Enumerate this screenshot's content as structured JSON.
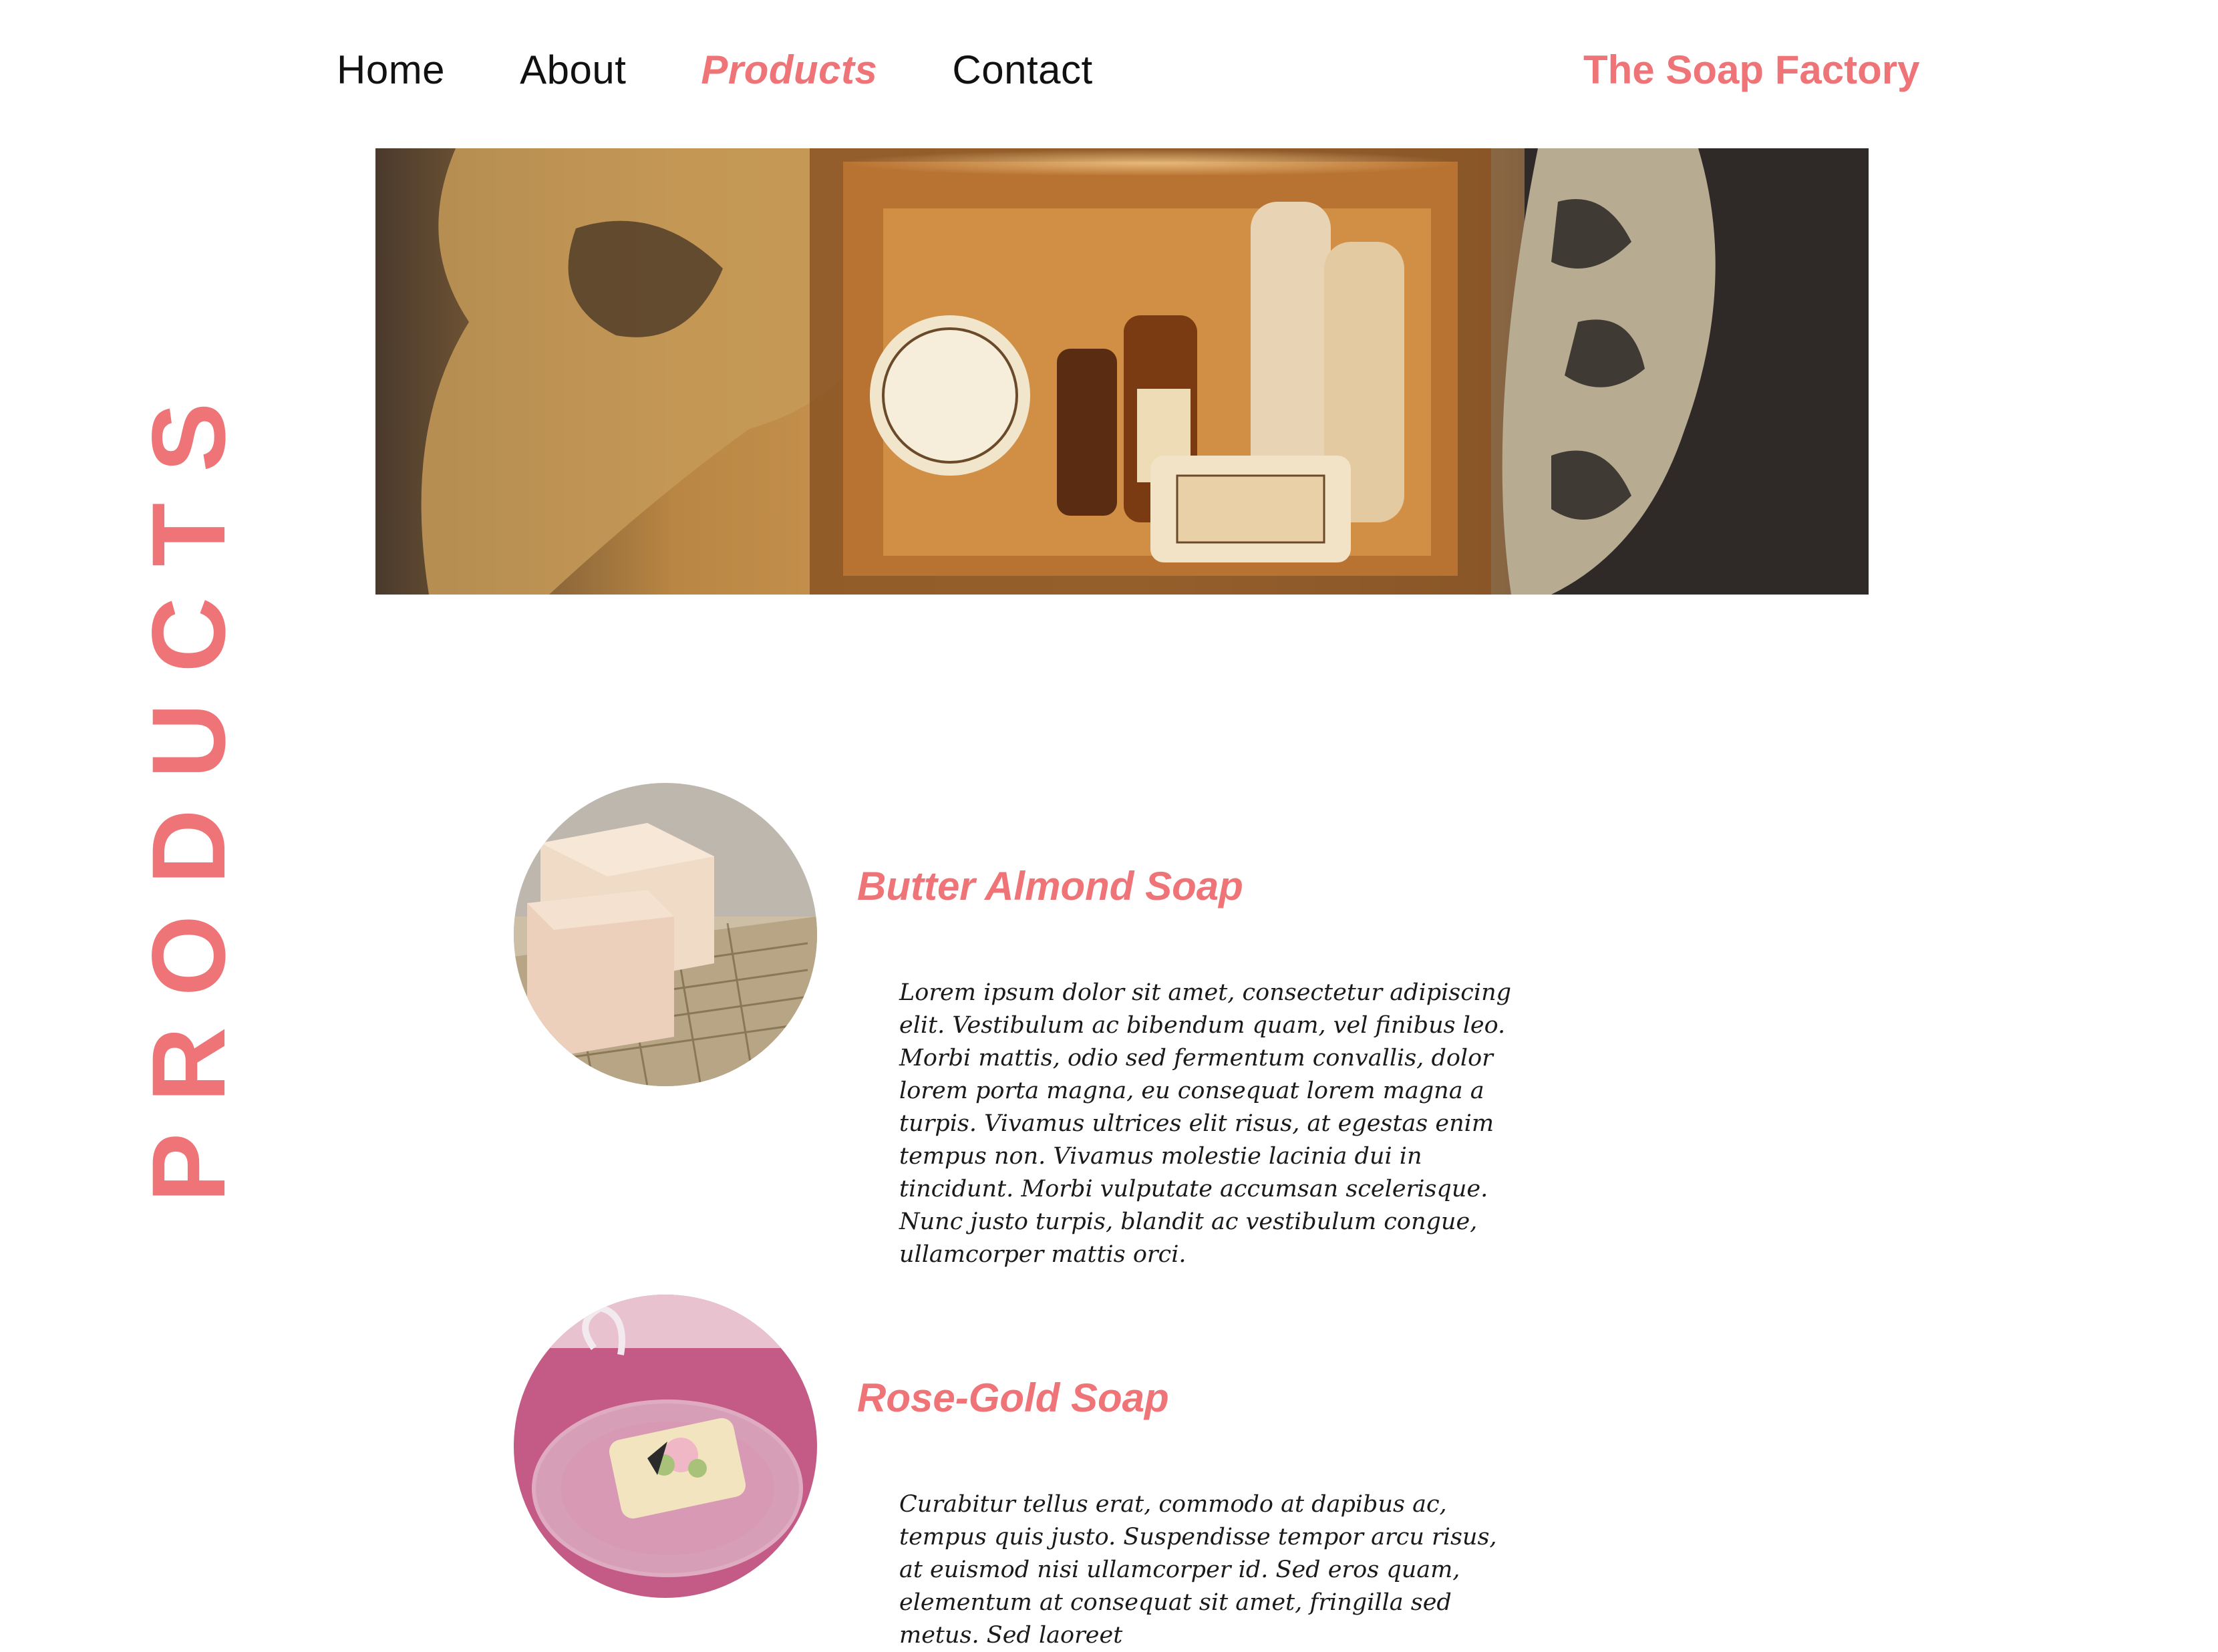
{
  "nav": {
    "items": [
      {
        "label": "Home",
        "active": false
      },
      {
        "label": "About",
        "active": false
      },
      {
        "label": "Products",
        "active": true
      },
      {
        "label": "Contact",
        "active": false
      }
    ],
    "brand": "The Soap Factory"
  },
  "hero": {
    "image_icon": "gift-box-photo"
  },
  "page_heading": "PRODUCTS",
  "products": [
    {
      "name": "Butter Almond Soap",
      "description": "Lorem ipsum dolor sit amet, consectetur adipiscing elit. Vestibulum ac bibendum quam, vel finibus leo. Morbi mattis, odio sed fermentum convallis, dolor lorem porta magna, eu consequat lorem magna a turpis. Vivamus ultrices elit risus, at egestas enim tempus non. Vivamus molestie lacinia dui in tincidunt. Morbi vulputate accumsan scelerisque. Nunc justo turpis, blandit ac vestibulum congue, ullamcorper mattis orci."
    },
    {
      "name": "Rose-Gold Soap",
      "description": "Curabitur tellus erat, commodo at dapibus ac, tempus quis justo. Suspendisse tempor arcu risus, at euismod nisi ullamcorper id. Sed eros quam, elementum at consequat sit amet, fringilla sed metus. Sed laoreet"
    }
  ],
  "colors": {
    "accent": "#ef7478",
    "text": "#111111",
    "background": "#ffffff"
  }
}
